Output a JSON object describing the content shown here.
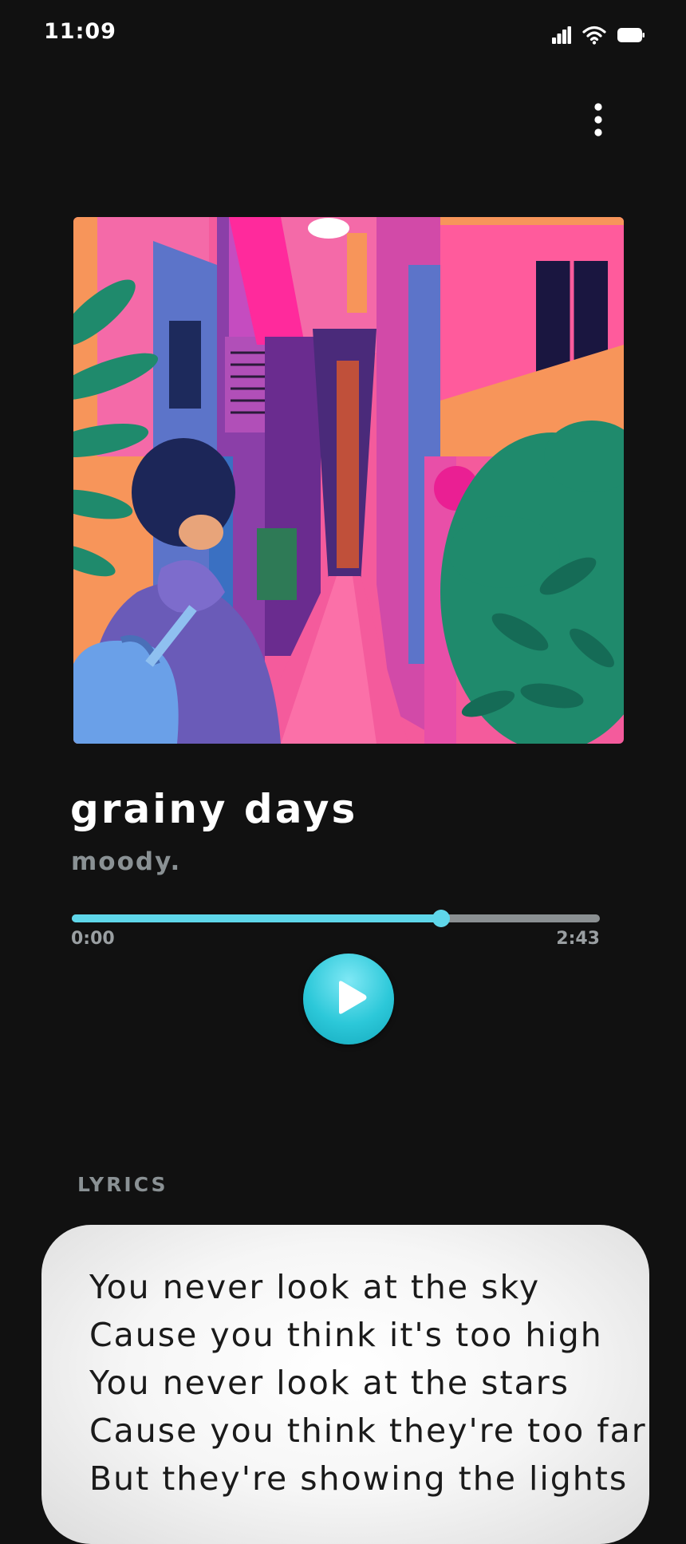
{
  "status_bar": {
    "time": "11:09",
    "icons": [
      "signal-icon",
      "wifi-icon",
      "battery-icon"
    ]
  },
  "header": {
    "menu_icon": "more-vertical-icon"
  },
  "track": {
    "title": "grainy days",
    "artist": "moody.",
    "album_art": "illustration of a person with a backpack in a neon-colored alley"
  },
  "player": {
    "elapsed": "0:00",
    "duration": "2:43",
    "progress": 0.7,
    "play_icon": "play-icon"
  },
  "lyrics": {
    "heading": "LYRICS",
    "lines": [
      "You never look at the sky",
      "Cause you think it's too high",
      "You never look at the stars",
      "Cause you think they're too far",
      "But they're showing the lights"
    ]
  },
  "colors": {
    "background": "#111111",
    "accent": "#5fd7ea",
    "muted_text": "#8a9194",
    "progress_track": "#8b9092",
    "lyrics_card": "#f6f6f6"
  }
}
